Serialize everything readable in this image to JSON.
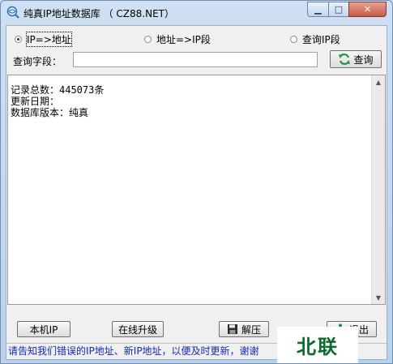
{
  "window": {
    "title": "纯真IP地址数据库 （ CZ88.NET）"
  },
  "modes": [
    {
      "label": "IP=>地址",
      "selected": true
    },
    {
      "label": "地址=>IP段",
      "selected": false
    },
    {
      "label": "查询IP段",
      "selected": false
    }
  ],
  "query": {
    "label": "查询字段：",
    "value": "",
    "button_label": "查询"
  },
  "output": {
    "text": "记录总数：445073条\n更新日期：\n数据库版本：纯真"
  },
  "buttons": {
    "local_ip": "本机IP",
    "online_update": "在线升级",
    "unzip": "解压",
    "exit": "退出"
  },
  "status": {
    "text": "请告知我们错误的IP地址、新IP地址，以便及时更新，谢谢"
  },
  "watermark": {
    "text": "北联"
  },
  "colors": {
    "status_text": "#1028c8",
    "watermark": "#0b6b2c"
  },
  "icons": {
    "app": "search-globe-icon",
    "query": "refresh-icon",
    "unzip": "floppy-disk-icon",
    "exit": "exit-person-icon"
  }
}
